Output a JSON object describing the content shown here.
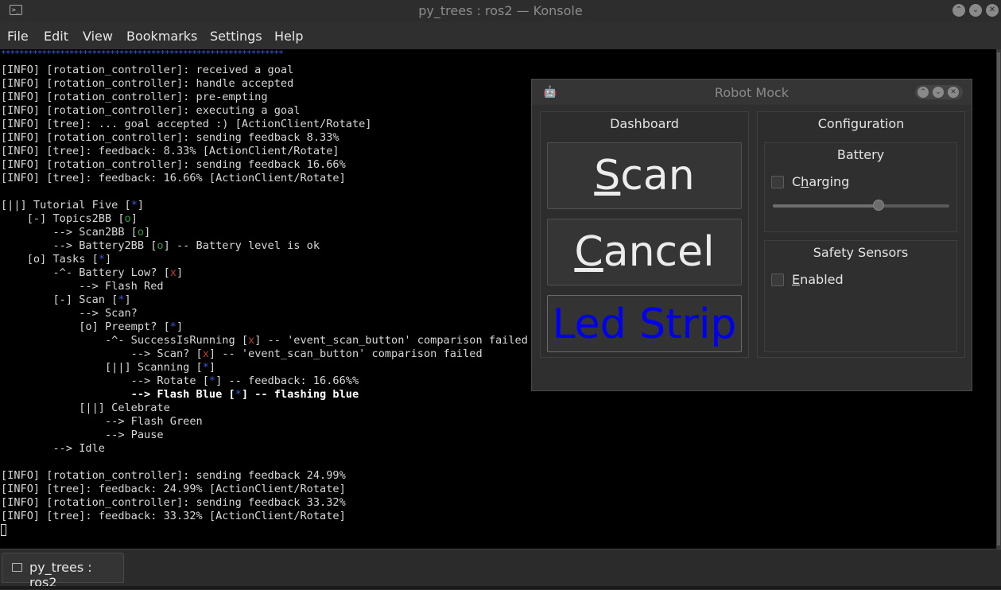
{
  "window": {
    "title": "py_trees : ros2 — Konsole",
    "app_icon_glyph": ">_",
    "buttons": [
      "⌃",
      "⌄",
      "✕"
    ]
  },
  "menubar": {
    "items": [
      "File",
      "Edit",
      "View",
      "Bookmarks",
      "Settings",
      "Help"
    ]
  },
  "terminal": {
    "stars": "**************************************************************",
    "lines": [
      [
        {
          "t": "[INFO] [rotation_controller]: received a goal"
        }
      ],
      [
        {
          "t": "[INFO] [rotation_controller]: handle accepted"
        }
      ],
      [
        {
          "t": "[INFO] [rotation_controller]: pre-empting"
        }
      ],
      [
        {
          "t": "[INFO] [rotation_controller]: executing a goal"
        }
      ],
      [
        {
          "t": "[INFO] [tree]: ... goal accepted :) [ActionClient/Rotate]"
        }
      ],
      [
        {
          "t": "[INFO] [rotation_controller]: sending feedback 8.33%"
        }
      ],
      [
        {
          "t": "[INFO] [tree]: feedback: 8.33% [ActionClient/Rotate]"
        }
      ],
      [
        {
          "t": "[INFO] [rotation_controller]: sending feedback 16.66%"
        }
      ],
      [
        {
          "t": "[INFO] [tree]: feedback: 16.66% [ActionClient/Rotate]"
        }
      ],
      [
        {
          "t": ""
        }
      ],
      [
        {
          "t": "[||] Tutorial Five ["
        },
        {
          "t": "*",
          "c": "c-blue"
        },
        {
          "t": "]"
        }
      ],
      [
        {
          "t": "    [-] Topics2BB ["
        },
        {
          "t": "o",
          "c": "c-green"
        },
        {
          "t": "]"
        }
      ],
      [
        {
          "t": "        --> Scan2BB ["
        },
        {
          "t": "o",
          "c": "c-green"
        },
        {
          "t": "]"
        }
      ],
      [
        {
          "t": "        --> Battery2BB ["
        },
        {
          "t": "o",
          "c": "c-green"
        },
        {
          "t": "] -- Battery level is ok"
        }
      ],
      [
        {
          "t": "    [o] Tasks ["
        },
        {
          "t": "*",
          "c": "c-blue"
        },
        {
          "t": "]"
        }
      ],
      [
        {
          "t": "        -^- Battery Low? ["
        },
        {
          "t": "x",
          "c": "c-red"
        },
        {
          "t": "]"
        }
      ],
      [
        {
          "t": "            --> Flash Red"
        }
      ],
      [
        {
          "t": "        [-] Scan ["
        },
        {
          "t": "*",
          "c": "c-blue"
        },
        {
          "t": "]"
        }
      ],
      [
        {
          "t": "            --> Scan?"
        }
      ],
      [
        {
          "t": "            [o] Preempt? ["
        },
        {
          "t": "*",
          "c": "c-blue"
        },
        {
          "t": "]"
        }
      ],
      [
        {
          "t": "                -^- SuccessIsRunning ["
        },
        {
          "t": "x",
          "c": "c-red"
        },
        {
          "t": "] -- 'event_scan_button' comparison failed"
        }
      ],
      [
        {
          "t": "                    --> Scan? ["
        },
        {
          "t": "x",
          "c": "c-red"
        },
        {
          "t": "] -- 'event_scan_button' comparison failed"
        }
      ],
      [
        {
          "t": "                [||] Scanning ["
        },
        {
          "t": "*",
          "c": "c-blue"
        },
        {
          "t": "]"
        }
      ],
      [
        {
          "t": "                    --> Rotate ["
        },
        {
          "t": "*",
          "c": "c-blue"
        },
        {
          "t": "] -- feedback: 16.66%%"
        }
      ],
      [
        {
          "t": "                    --> Flash Blue [",
          "c": "bold"
        },
        {
          "t": "*",
          "c": "c-blue"
        },
        {
          "t": "] -- flashing blue",
          "c": "bold"
        }
      ],
      [
        {
          "t": "            [||] Celebrate"
        }
      ],
      [
        {
          "t": "                --> Flash Green"
        }
      ],
      [
        {
          "t": "                --> Pause"
        }
      ],
      [
        {
          "t": "        --> Idle"
        }
      ],
      [
        {
          "t": ""
        }
      ],
      [
        {
          "t": "[INFO] [rotation_controller]: sending feedback 24.99%"
        }
      ],
      [
        {
          "t": "[INFO] [tree]: feedback: 24.99% [ActionClient/Rotate]"
        }
      ],
      [
        {
          "t": "[INFO] [rotation_controller]: sending feedback 33.32%"
        }
      ],
      [
        {
          "t": "[INFO] [tree]: feedback: 33.32% [ActionClient/Rotate]"
        }
      ]
    ]
  },
  "tabs": [
    {
      "label": "py_trees : ros2"
    }
  ],
  "robot_mock": {
    "title": "Robot Mock",
    "icon_glyph": "🤖",
    "buttons": [
      "⌃",
      "⌄",
      "✕"
    ],
    "dashboard": {
      "title": "Dashboard",
      "scan_label": "Scan",
      "cancel_label": "Cancel",
      "led_strip_label": "Led Strip",
      "led_strip_color": "#0000ee"
    },
    "configuration": {
      "title": "Configuration",
      "battery": {
        "title": "Battery",
        "charging_label": "Charging",
        "charging_checked": false,
        "level_fraction": 0.6
      },
      "safety_sensors": {
        "title": "Safety Sensors",
        "enabled_label": "Enabled",
        "enabled_checked": false
      }
    }
  }
}
